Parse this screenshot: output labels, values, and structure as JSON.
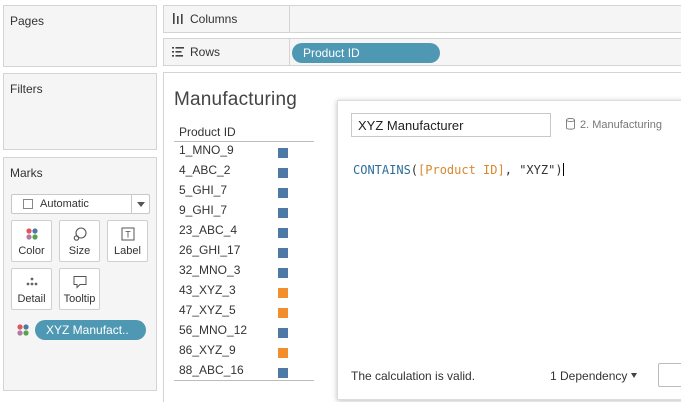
{
  "panels": {
    "pages": "Pages",
    "filters": "Filters",
    "marks": "Marks"
  },
  "marks": {
    "type": "Automatic",
    "buttons": [
      "Color",
      "Size",
      "Label",
      "Detail",
      "Tooltip"
    ],
    "color_pill": "XYZ Manufact.."
  },
  "shelves": {
    "columns": "Columns",
    "rows": "Rows",
    "rows_pill": "Product ID"
  },
  "view": {
    "title": "Manufacturing",
    "header": "Product ID",
    "rows": [
      {
        "label": "1_MNO_9",
        "match": false
      },
      {
        "label": "4_ABC_2",
        "match": false
      },
      {
        "label": "5_GHI_7",
        "match": false
      },
      {
        "label": "9_GHI_7",
        "match": false
      },
      {
        "label": "23_ABC_4",
        "match": false
      },
      {
        "label": "26_GHI_17",
        "match": false
      },
      {
        "label": "32_MNO_3",
        "match": false
      },
      {
        "label": "43_XYZ_3",
        "match": true
      },
      {
        "label": "47_XYZ_5",
        "match": true
      },
      {
        "label": "56_MNO_12",
        "match": false
      },
      {
        "label": "86_XYZ_9",
        "match": true
      },
      {
        "label": "88_ABC_16",
        "match": false
      }
    ]
  },
  "colors": {
    "false_color": "#4e79a7",
    "true_color": "#f28e2b",
    "pill": "#4e98b4"
  },
  "calc": {
    "name": "XYZ Manufacturer",
    "source": "2. Manufacturing",
    "formula_fn": "CONTAINS",
    "formula_open": "(",
    "formula_field": "[Product ID]",
    "formula_sep": ", ",
    "formula_str": "\"XYZ\"",
    "formula_close": ")",
    "status": "The calculation is valid.",
    "dependency": "1 Dependency"
  }
}
